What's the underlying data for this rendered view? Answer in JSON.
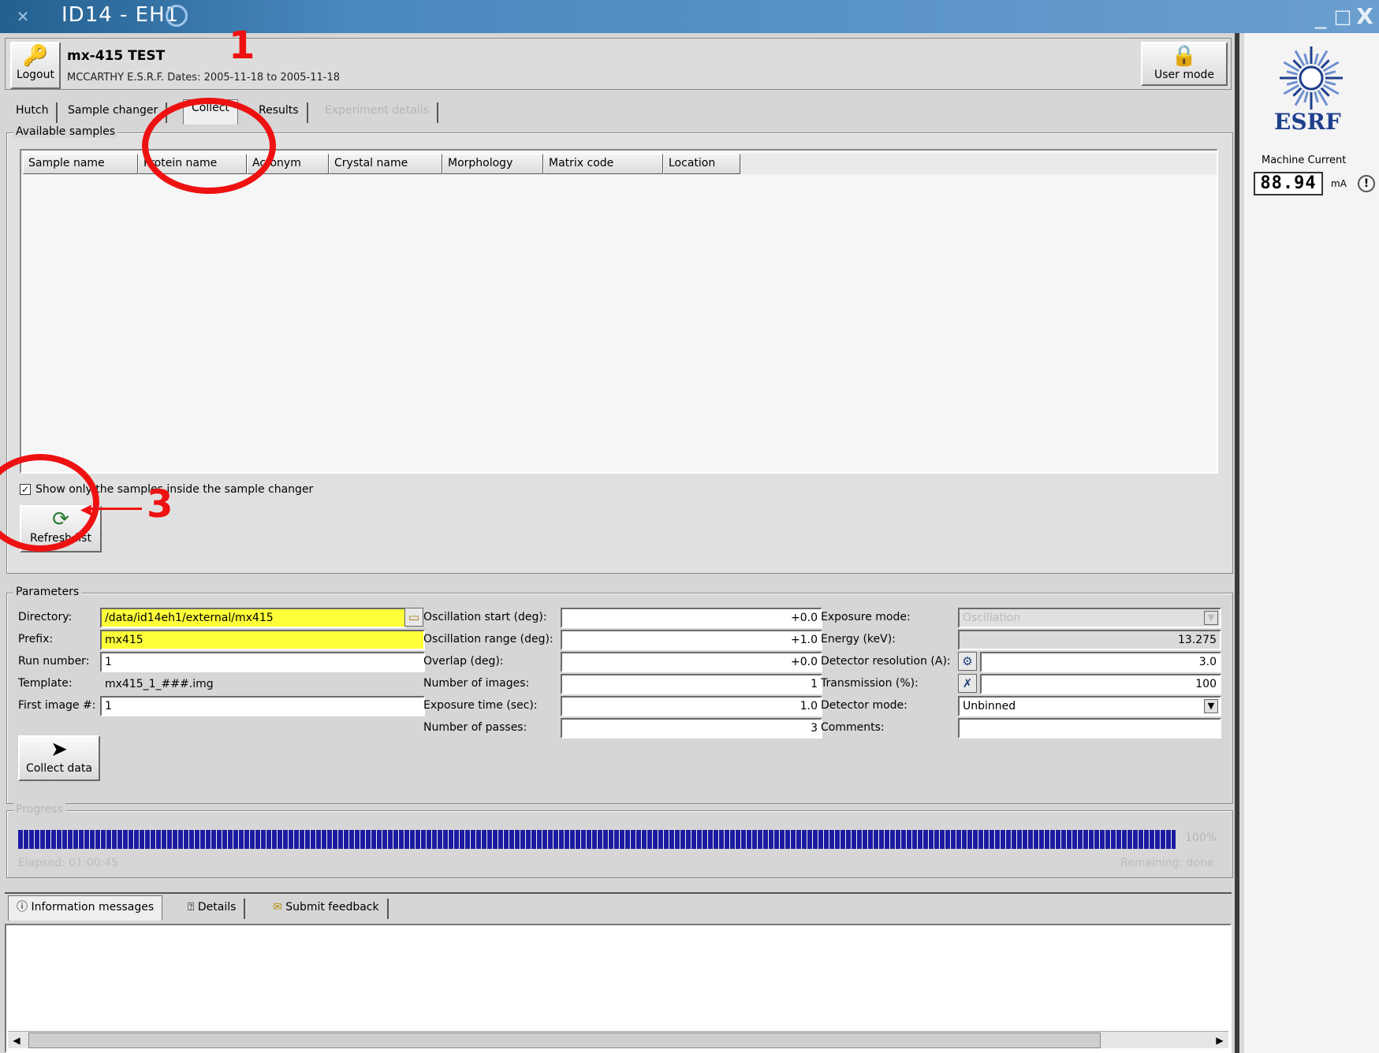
{
  "window": {
    "title": "ID14 - EH1",
    "icon": "x-icon",
    "controls": {
      "minimize": "_",
      "maximize": "□",
      "close": "X"
    }
  },
  "header": {
    "logout_label": "Logout",
    "project_title": "mx-415 TEST",
    "project_subtitle": "MCCARTHY E.S.R.F. Dates: 2005-11-18 to 2005-11-18",
    "user_mode_label": "User mode"
  },
  "tabs": [
    {
      "label": "Hutch",
      "active": false
    },
    {
      "label": "Sample changer",
      "active": false
    },
    {
      "label": "Collect",
      "active": true
    },
    {
      "label": "Results",
      "active": false
    },
    {
      "label": "Experiment details",
      "active": false,
      "disabled": true
    }
  ],
  "samples": {
    "group_title": "Available samples",
    "columns": [
      "Sample name",
      "Protein name",
      "Acronym",
      "Crystal name",
      "Morphology",
      "Matrix code",
      "Location"
    ],
    "rows": [],
    "show_only_label": "Show only the samples inside the sample changer",
    "show_only_checked": true,
    "show_only_mark": "✓",
    "refresh_label": "Refresh list"
  },
  "parameters": {
    "group_title": "Parameters",
    "directory_label": "Directory:",
    "directory": "/data/id14eh1/external/mx415",
    "prefix_label": "Prefix:",
    "prefix": "mx415",
    "run_number_label": "Run number:",
    "run_number": "1",
    "template_label": "Template:",
    "template": "mx415_1_###.img",
    "first_image_label": "First image #:",
    "first_image": "1",
    "osc_start_label": "Oscillation start (deg):",
    "osc_start": "+0.0",
    "osc_range_label": "Oscillation range (deg):",
    "osc_range": "+1.0",
    "overlap_label": "Overlap (deg):",
    "overlap": "+0.0",
    "num_images_label": "Number of images:",
    "num_images": "1",
    "exposure_time_label": "Exposure time (sec):",
    "exposure_time": "1.0",
    "num_passes_label": "Number of passes:",
    "num_passes": "3",
    "exposure_mode_label": "Exposure mode:",
    "exposure_mode": "Oscillation",
    "energy_label": "Energy (keV):",
    "energy": "13.275",
    "det_resolution_label": "Detector resolution (A):",
    "det_resolution": "3.0",
    "transmission_label": "Transmission (%):",
    "transmission": "100",
    "detector_mode_label": "Detector mode:",
    "detector_mode": "Unbinned",
    "comments_label": "Comments:",
    "comments": "",
    "collect_label": "Collect data"
  },
  "progress": {
    "group_title": "Progress",
    "percent_text": "100%",
    "fraction": 1.0,
    "elapsed": "Elapsed: 01:00:45",
    "remaining": "Remaining: done"
  },
  "messages": {
    "tabs": [
      {
        "label": "Information messages",
        "icon": "info-icon",
        "active": true
      },
      {
        "label": "Details",
        "icon": "help-icon",
        "active": false
      },
      {
        "label": "Submit feedback",
        "icon": "envelope-icon",
        "active": false
      }
    ]
  },
  "side": {
    "logo_text": "ESRF",
    "machine_current_label": "Machine Current",
    "machine_current": "88.94",
    "unit": "mA"
  },
  "annotations": {
    "one": "1",
    "three": "3"
  },
  "colors": {
    "progress": "#1b1ba1",
    "highlight_field": "#ffff3a",
    "annotation": "#ee1111",
    "titlebar": "#4a87bf"
  }
}
